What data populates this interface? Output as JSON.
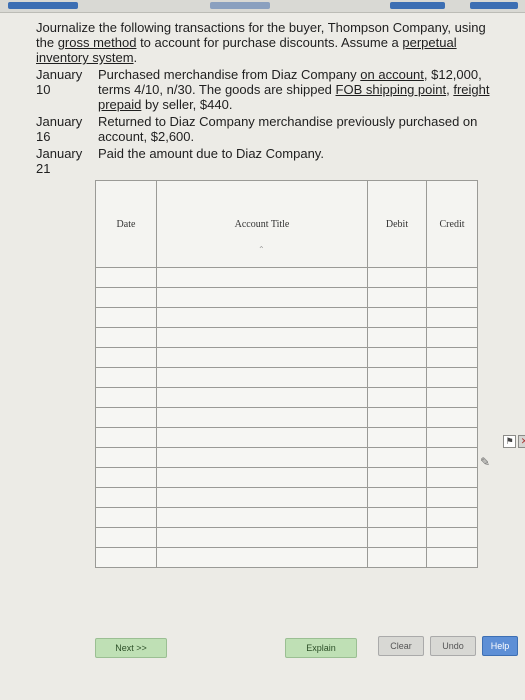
{
  "instructions": {
    "intro_pre": "Journalize the following transactions for the buyer, Thompson Company, using the ",
    "intro_link": "gross method",
    "intro_mid": " to account for purchase discounts. Assume a ",
    "intro_link2": "perpetual inventory system",
    "intro_post": ".",
    "transactions": [
      {
        "date": "January 10",
        "pre": "Purchased merchandise from Diaz Company ",
        "link1": "on account",
        "mid": ", $12,000, terms 4/10, n/30. The goods are shipped ",
        "link2": "FOB shipping point",
        "mid2": ", ",
        "link3": "freight prepaid",
        "post": " by seller, $440."
      },
      {
        "date": "January 16",
        "pre": "Returned to Diaz Company merchandise previously purchased on account, $2,600."
      },
      {
        "date": "January 21",
        "pre": "Paid the amount due to Diaz Company."
      }
    ]
  },
  "journal": {
    "headers": {
      "date": "Date",
      "account": "Account Title",
      "debit": "Debit",
      "credit": "Credit"
    },
    "row_count": 15
  },
  "buttons": {
    "next": "Next >>",
    "explain": "Explain",
    "clear": "Clear",
    "undo": "Undo",
    "help": "Help"
  }
}
